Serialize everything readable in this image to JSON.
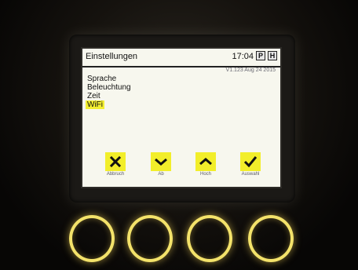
{
  "header": {
    "title": "Einstellungen",
    "time": "17:04",
    "badge_p": "P",
    "badge_h": "H"
  },
  "version": "V1.123 Aug 24 2015",
  "menu": {
    "items": [
      {
        "label": "Sprache",
        "selected": false
      },
      {
        "label": "Beleuchtung",
        "selected": false
      },
      {
        "label": "Zeit",
        "selected": false
      },
      {
        "label": "WiFi",
        "selected": true
      }
    ]
  },
  "softkeys": [
    {
      "label": "Abbruch",
      "icon": "close-icon"
    },
    {
      "label": "Ab",
      "icon": "chevron-down-icon"
    },
    {
      "label": "Hoch",
      "icon": "chevron-up-icon"
    },
    {
      "label": "Auswahl",
      "icon": "checkmark-icon"
    }
  ],
  "colors": {
    "highlight": "#f3ef32",
    "ring": "#f3e26a",
    "screen": "#f7f7ee"
  }
}
